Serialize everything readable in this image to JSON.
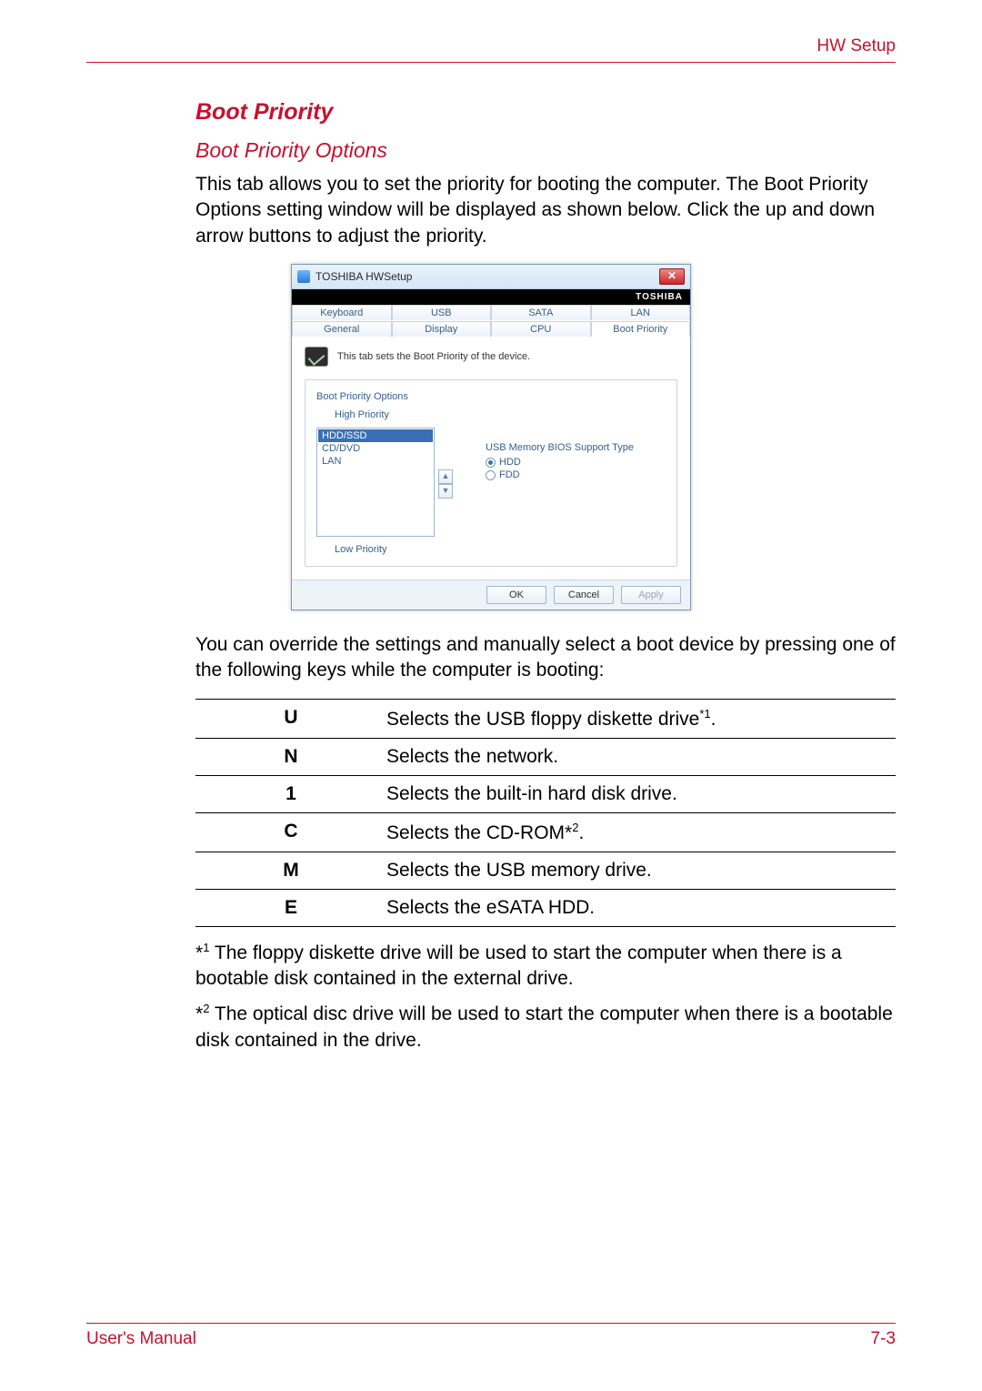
{
  "header": {
    "right": "HW Setup"
  },
  "headings": {
    "h1": "Boot Priority",
    "h2": "Boot Priority Options"
  },
  "intro": "This tab allows you to set the priority for booting the computer. The Boot Priority Options setting window will be displayed as shown below. Click the up and down arrow buttons to adjust the priority.",
  "dialog": {
    "title": "TOSHIBA HWSetup",
    "brand": "TOSHIBA",
    "tabs_row1": [
      "Keyboard",
      "USB",
      "SATA",
      "LAN"
    ],
    "tabs_row2": [
      "General",
      "Display",
      "CPU",
      "Boot Priority"
    ],
    "active_tab": "Boot Priority",
    "caption": "This tab sets the Boot Priority of the device.",
    "group_title": "Boot Priority Options",
    "high_label": "High Priority",
    "low_label": "Low Priority",
    "list_items": [
      "HDD/SSD",
      "CD/DVD",
      "LAN"
    ],
    "selected_item": "HDD/SSD",
    "support_title": "USB Memory BIOS Support Type",
    "radio_hdd": "HDD",
    "radio_fdd": "FDD",
    "buttons": {
      "ok": "OK",
      "cancel": "Cancel",
      "apply": "Apply"
    }
  },
  "para_after": "You can override the settings and manually select a boot device by pressing one of the following keys while the computer is booting:",
  "key_table": [
    {
      "key": "U",
      "desc": "Selects the USB floppy diskette drive",
      "sup": "*1",
      "tail": "."
    },
    {
      "key": "N",
      "desc": "Selects the network.",
      "sup": "",
      "tail": ""
    },
    {
      "key": "1",
      "desc": "Selects the built-in hard disk drive.",
      "sup": "",
      "tail": ""
    },
    {
      "key": "C",
      "desc": "Selects the CD-ROM*",
      "sup": "2",
      "tail": "."
    },
    {
      "key": "M",
      "desc": "Selects the USB memory drive.",
      "sup": "",
      "tail": ""
    },
    {
      "key": "E",
      "desc": "Selects the eSATA HDD.",
      "sup": "",
      "tail": ""
    }
  ],
  "footnotes": {
    "f1_pre": "*",
    "f1_sup": "1",
    "f1_text": " The floppy diskette drive will be used to start the computer when there is a bootable disk contained in the external drive.",
    "f2_pre": "*",
    "f2_sup": "2",
    "f2_text": " The optical disc drive will be used to start the computer when there is a bootable disk contained in the drive."
  },
  "footer": {
    "left": "User's Manual",
    "right": "7-3"
  }
}
